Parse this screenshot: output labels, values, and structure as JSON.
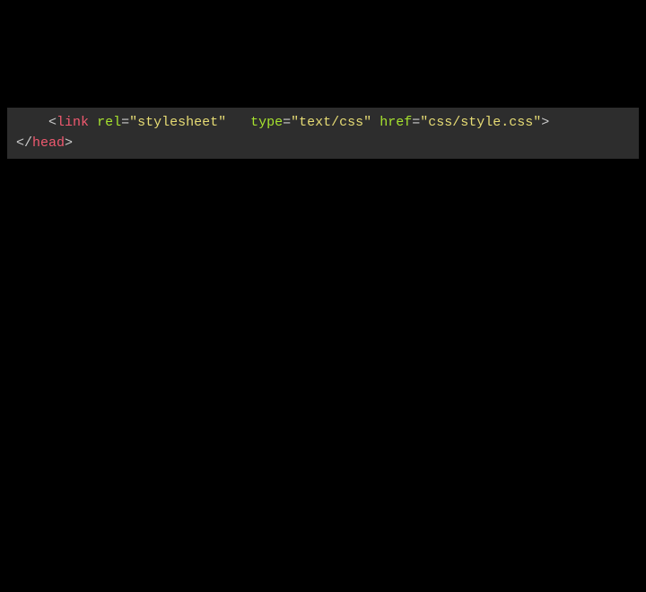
{
  "code": {
    "line1": {
      "indent": "    ",
      "open_bracket": "<",
      "tag": "link",
      "space1": " ",
      "attr1_name": "rel",
      "eq1": "=",
      "attr1_val": "\"stylesheet\"",
      "space2": "   ",
      "attr2_name": "type",
      "eq2": "=",
      "attr2_val": "\"text/css\"",
      "space3": " ",
      "attr3_name": "href",
      "eq3": "=",
      "attr3_val": "\"css/style.css\"",
      "close_bracket": ">"
    },
    "line2": {
      "open_bracket": "</",
      "tag": "head",
      "close_bracket": ">"
    }
  }
}
